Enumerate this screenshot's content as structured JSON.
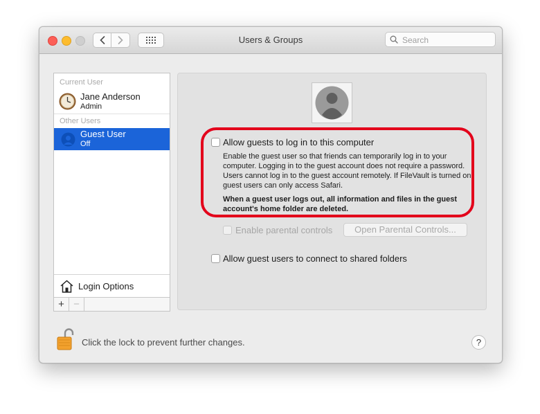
{
  "window": {
    "title": "Users & Groups"
  },
  "toolbar": {
    "back_icon": "chevron-left-icon",
    "forward_icon": "chevron-right-icon",
    "grid_icon": "grid-icon",
    "search_placeholder": "Search"
  },
  "sidebar": {
    "current_user_label": "Current User",
    "current_user": {
      "name": "Jane Anderson",
      "role": "Admin"
    },
    "other_users_label": "Other Users",
    "guest_user": {
      "name": "Guest User",
      "status": "Off"
    },
    "login_options_label": "Login Options",
    "add_symbol": "+",
    "remove_symbol": "−"
  },
  "panel": {
    "allow_guests_label": "Allow guests to log in to this computer",
    "allow_guests_checked": false,
    "description": "Enable the guest user so that friends can temporarily log in to your computer. Logging in to the guest account does not require a password. Users cannot log in to the guest account remotely. If FileVault is turned on guest users can only access Safari.",
    "warning": "When a guest user logs out, all information and files in the guest account's home folder are deleted.",
    "parental_controls_label": "Enable parental controls",
    "open_parental_controls_label": "Open Parental Controls...",
    "shared_folders_label": "Allow guest users to connect to shared folders",
    "shared_folders_checked": false
  },
  "footer": {
    "lock_text": "Click the lock to prevent further changes.",
    "help_label": "?"
  },
  "colors": {
    "selection": "#1b64d9",
    "highlight_ring": "#e3001b"
  }
}
